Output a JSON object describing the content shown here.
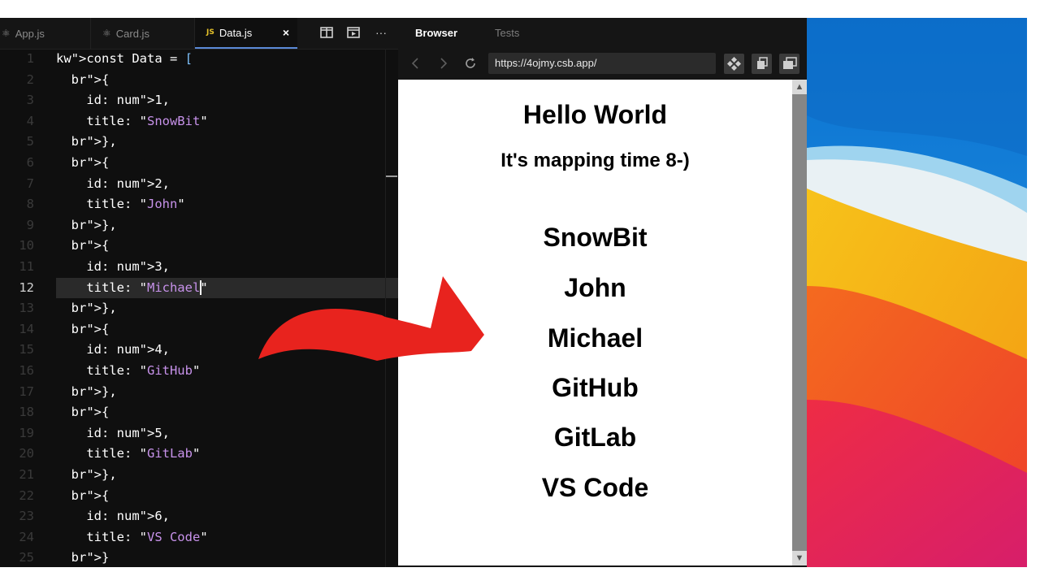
{
  "editor": {
    "tabs": [
      {
        "label": "App.js",
        "icon": "react-icon"
      },
      {
        "label": "Card.js",
        "icon": "react-icon"
      },
      {
        "label": "Data.js",
        "icon": "js-file-icon",
        "badge": "JS",
        "active": true
      }
    ],
    "close_glyph": "×",
    "toolbar": [
      {
        "name": "split-view-icon"
      },
      {
        "name": "preview-icon"
      },
      {
        "name": "more-icon",
        "glyph": "···"
      }
    ],
    "active_line": 12,
    "code_lines": [
      {
        "n": "1",
        "t": "const Data = ["
      },
      {
        "n": "2",
        "t": "  {"
      },
      {
        "n": "3",
        "t": "    id: 1,"
      },
      {
        "n": "4",
        "t": "    title: \"SnowBit\""
      },
      {
        "n": "5",
        "t": "  },"
      },
      {
        "n": "6",
        "t": "  {"
      },
      {
        "n": "7",
        "t": "    id: 2,"
      },
      {
        "n": "8",
        "t": "    title: \"John\""
      },
      {
        "n": "9",
        "t": "  },"
      },
      {
        "n": "10",
        "t": "  {"
      },
      {
        "n": "11",
        "t": "    id: 3,"
      },
      {
        "n": "12",
        "t": "    title: \"Michael\""
      },
      {
        "n": "13",
        "t": "  },"
      },
      {
        "n": "14",
        "t": "  {"
      },
      {
        "n": "15",
        "t": "    id: 4,"
      },
      {
        "n": "16",
        "t": "    title: \"GitHub\""
      },
      {
        "n": "17",
        "t": "  },"
      },
      {
        "n": "18",
        "t": "  {"
      },
      {
        "n": "19",
        "t": "    id: 5,"
      },
      {
        "n": "20",
        "t": "    title: \"GitLab\""
      },
      {
        "n": "21",
        "t": "  },"
      },
      {
        "n": "22",
        "t": "  {"
      },
      {
        "n": "23",
        "t": "    id: 6,"
      },
      {
        "n": "24",
        "t": "    title: \"VS Code\""
      },
      {
        "n": "25",
        "t": "  }"
      }
    ]
  },
  "browser": {
    "tabs": {
      "browser": "Browser",
      "tests": "Tests"
    },
    "url": "https://4ojmy.csb.app/",
    "page": {
      "heading": "Hello World",
      "subheading": "It's mapping time 8-)",
      "items": [
        "SnowBit",
        "John",
        "Michael",
        "GitHub",
        "GitLab",
        "VS Code"
      ]
    }
  },
  "colors": {
    "editor_bg": "#0f0f0f",
    "keyword": "#79b8ff",
    "number": "#e0533c",
    "string": "#c792ea",
    "arrow": "#e8231e"
  }
}
